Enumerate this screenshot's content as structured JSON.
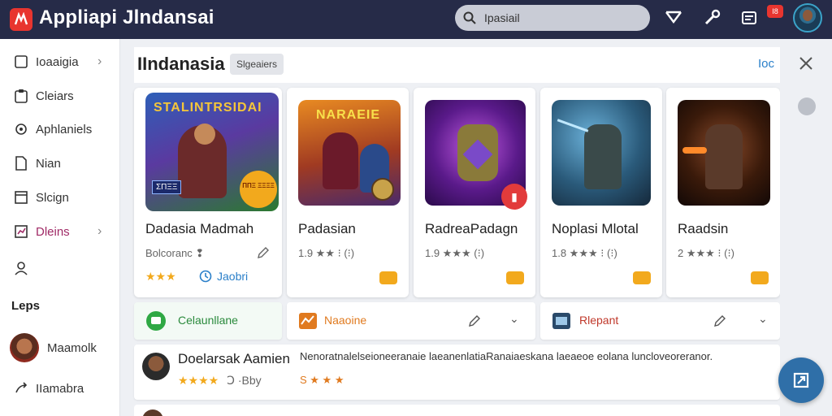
{
  "app": {
    "title": "Appliapi  Jlndansai"
  },
  "search": {
    "value": "Ipasiail"
  },
  "topbar": {
    "badge": "I8"
  },
  "sidebar": {
    "items": [
      {
        "label": "Ioaaigia",
        "icon": "square-icon",
        "chevron": "›"
      },
      {
        "label": "Cleiars",
        "icon": "clipboard-icon"
      },
      {
        "label": "Aphlaniels",
        "icon": "gear-icon"
      },
      {
        "label": "Nian",
        "icon": "document-icon"
      },
      {
        "label": "Slcign",
        "icon": "window-icon"
      },
      {
        "label": "Dleins",
        "icon": "chart-icon",
        "chevron": "›"
      }
    ],
    "section_title": "Leps",
    "users": [
      {
        "label": "Maamolk"
      },
      {
        "label": "IIamabra"
      }
    ]
  },
  "header": {
    "title": "IIndanasia",
    "chip": "Slgeaiers",
    "link": "Ioc"
  },
  "cards": [
    {
      "name": "Dadasia Madmah",
      "meta": "Bolcoranc ❢",
      "stars": "★★★",
      "extra": "Jaobri",
      "art_text": "STALINTRSIDAI",
      "art_badge": "ΣΠΞΞ",
      "art_corner": "ΠΠΞ ΞΞΞΞ"
    },
    {
      "name": "Padasian",
      "meta": "1.9 ★★ ⁝ (⁝)",
      "art_text": "NARAEIE"
    },
    {
      "name": "RadreaPadagn",
      "meta": "1.9 ★★★ (⁝)"
    },
    {
      "name": "Noplasi Mlotal",
      "meta": "1.8 ★★★ ⁝ (⁝)"
    },
    {
      "name": "Raadsin",
      "meta": "2 ★★★ ⁝ (⁝)"
    }
  ],
  "row2": [
    {
      "label": "Celaunllane",
      "color": "#2a8a3c"
    },
    {
      "label": "Naaoine",
      "color": "#e07a1f"
    },
    {
      "label": "Rlepant",
      "color": "#c0392b"
    }
  ],
  "review": {
    "name": "Doelarsak Aamien",
    "stars": "★★★★",
    "count": "Ↄ ·Bby",
    "text": "Nenoratnalelseioneeranaie laeanenlatiaRanaiaeskana laeaeoe eolana luncloveoreranor.",
    "stars2": "S ★ ★ ★"
  },
  "colors": {
    "topbar": "#262b48",
    "accent": "#2a7fc9",
    "star": "#f2a91d",
    "badge": "#e8352f",
    "fab": "#2f6fa8"
  }
}
